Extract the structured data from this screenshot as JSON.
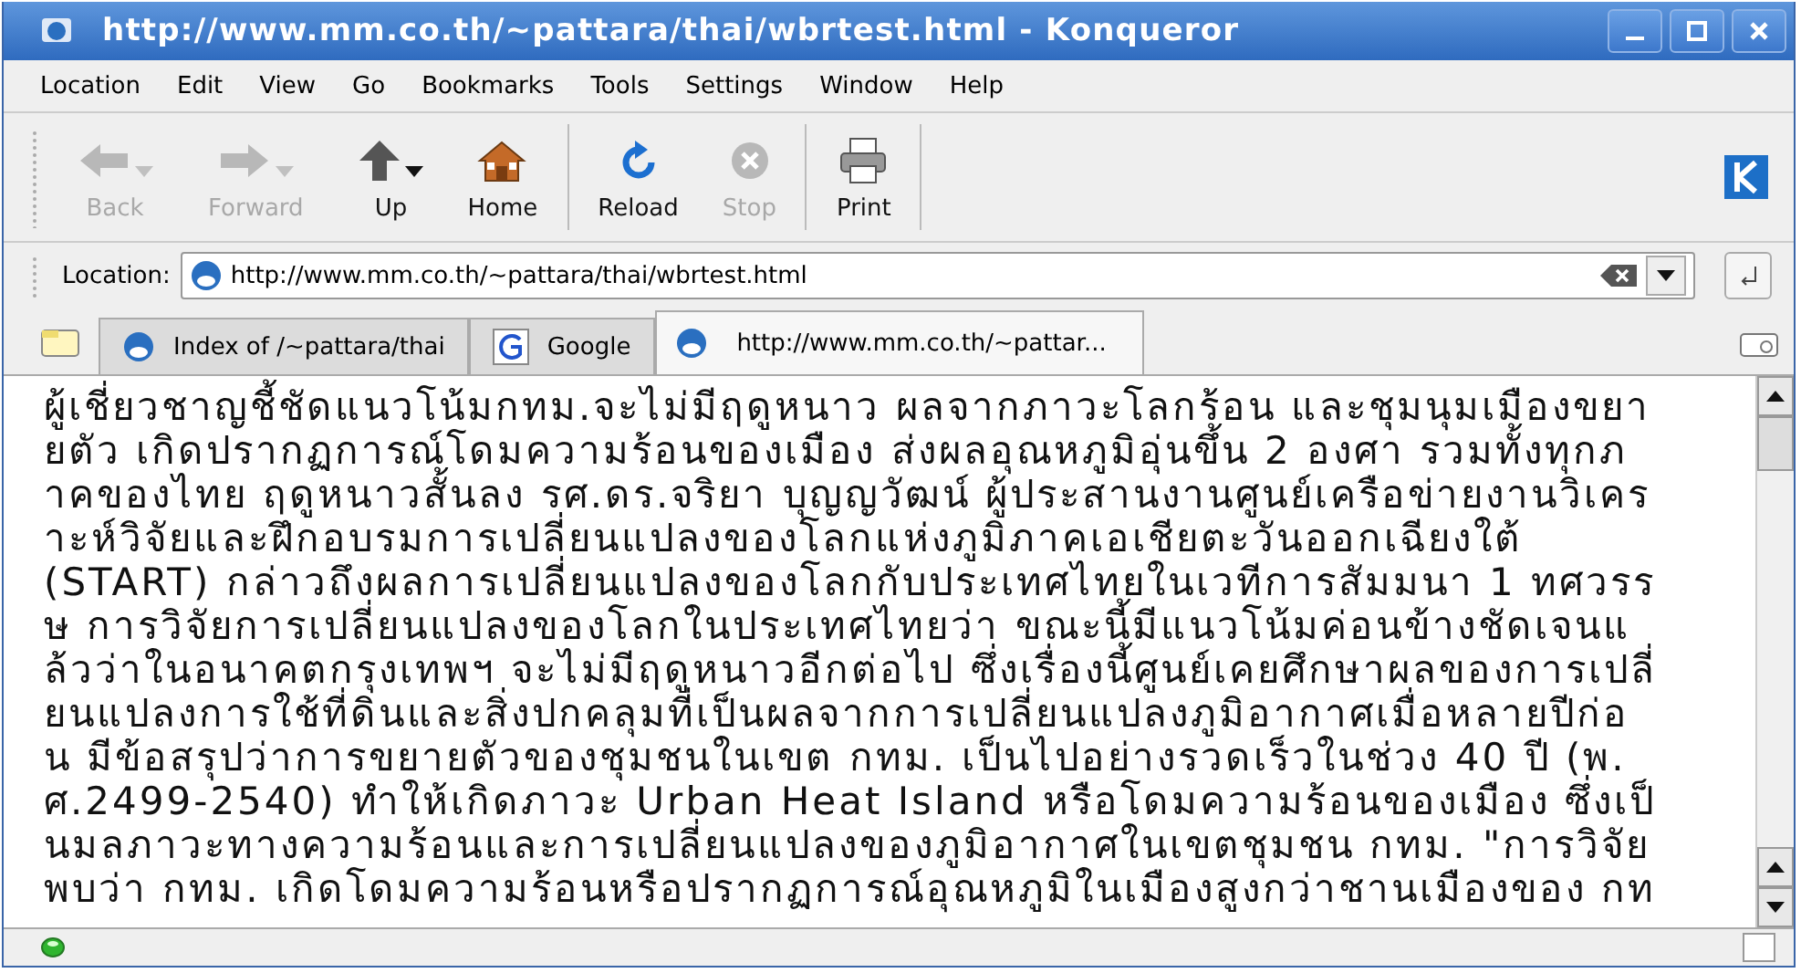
{
  "window": {
    "title": "http://www.mm.co.th/~pattara/thai/wbrtest.html - Konqueror"
  },
  "menu": [
    "Location",
    "Edit",
    "View",
    "Go",
    "Bookmarks",
    "Tools",
    "Settings",
    "Window",
    "Help"
  ],
  "toolbar": [
    {
      "kind": "back",
      "label": "Back",
      "disabled": true
    },
    {
      "kind": "forward",
      "label": "Forward",
      "disabled": true
    },
    {
      "kind": "up",
      "label": "Up",
      "disabled": false
    },
    {
      "kind": "home",
      "label": "Home",
      "disabled": false
    },
    {
      "kind": "reload",
      "label": "Reload",
      "disabled": false
    },
    {
      "kind": "stop",
      "label": "Stop",
      "disabled": true
    },
    {
      "kind": "print",
      "label": "Print",
      "disabled": false
    }
  ],
  "location": {
    "label": "Location:",
    "value": "http://www.mm.co.th/~pattara/thai/wbrtest.html"
  },
  "tabs": [
    {
      "label": "Index of /~pattara/thai",
      "selected": false
    },
    {
      "label": "Google",
      "selected": false
    },
    {
      "label": "http://www.mm.co.th/~pattar...",
      "selected": true
    }
  ],
  "article": {
    "lines": [
      "ผู้เชี่ยวชาญชี้ชัดแนวโน้มกทม.จะไม่มีฤดูหนาว ผลจากภาวะโลกร้อน และชุมนุมเมืองขยา",
      "ยตัว เกิดปรากฏการณ์โดมความร้อนของเมือง ส่งผลอุณหภูมิอุ่นขึ้น 2 องศา รวมทั้งทุกภ",
      "าคของไทย ฤดูหนาวสั้นลง รศ.ดร.จริยา บุญญวัฒน์ ผู้ประสานงานศูนย์เครือข่ายงานวิเคร",
      "าะห์วิจัยและฝึกอบรมการเปลี่ยนแปลงของโลกแห่งภูมิภาคเอเชียตะวันออกเฉียงใต้",
      "(START) กล่าวถึงผลการเปลี่ยนแปลงของโลกกับประเทศไทยในเวทีการสัมมนา 1 ทศวรร",
      "ษ การวิจัยการเปลี่ยนแปลงของโลกในประเทศไทยว่า ขณะนี้มีแนวโน้มค่อนข้างชัดเจนแ",
      "ล้วว่าในอนาคตกรุงเทพฯ จะไม่มีฤดูหนาวอีกต่อไป ซึ่งเรื่องนี้ศูนย์เคยศึกษาผลของการเปลี่",
      "ยนแปลงการใช้ที่ดินและสิ่งปกคลุมที่เป็นผลจากการเปลี่ยนแปลงภูมิอากาศเมื่อหลายปีก่อ",
      "น มีข้อสรุปว่าการขยายตัวของชุมชนในเขต กทม. เป็นไปอย่างรวดเร็วในช่วง 40 ปี (พ.",
      "ศ.2499-2540) ทำให้เกิดภาวะ Urban Heat Island หรือโดมความร้อนของเมือง ซึ่งเป็",
      "นมลภาวะทางความร้อนและการเปลี่ยนแปลงของภูมิอากาศในเขตชุมชน กทม. \"การวิจัย",
      "พบว่า กทม. เกิดโดมความร้อนหรือปรากฏการณ์อุณหภูมิในเมืองสูงกว่าชานเมืองของ กท"
    ]
  },
  "status_bar": {
    "connected": true
  }
}
